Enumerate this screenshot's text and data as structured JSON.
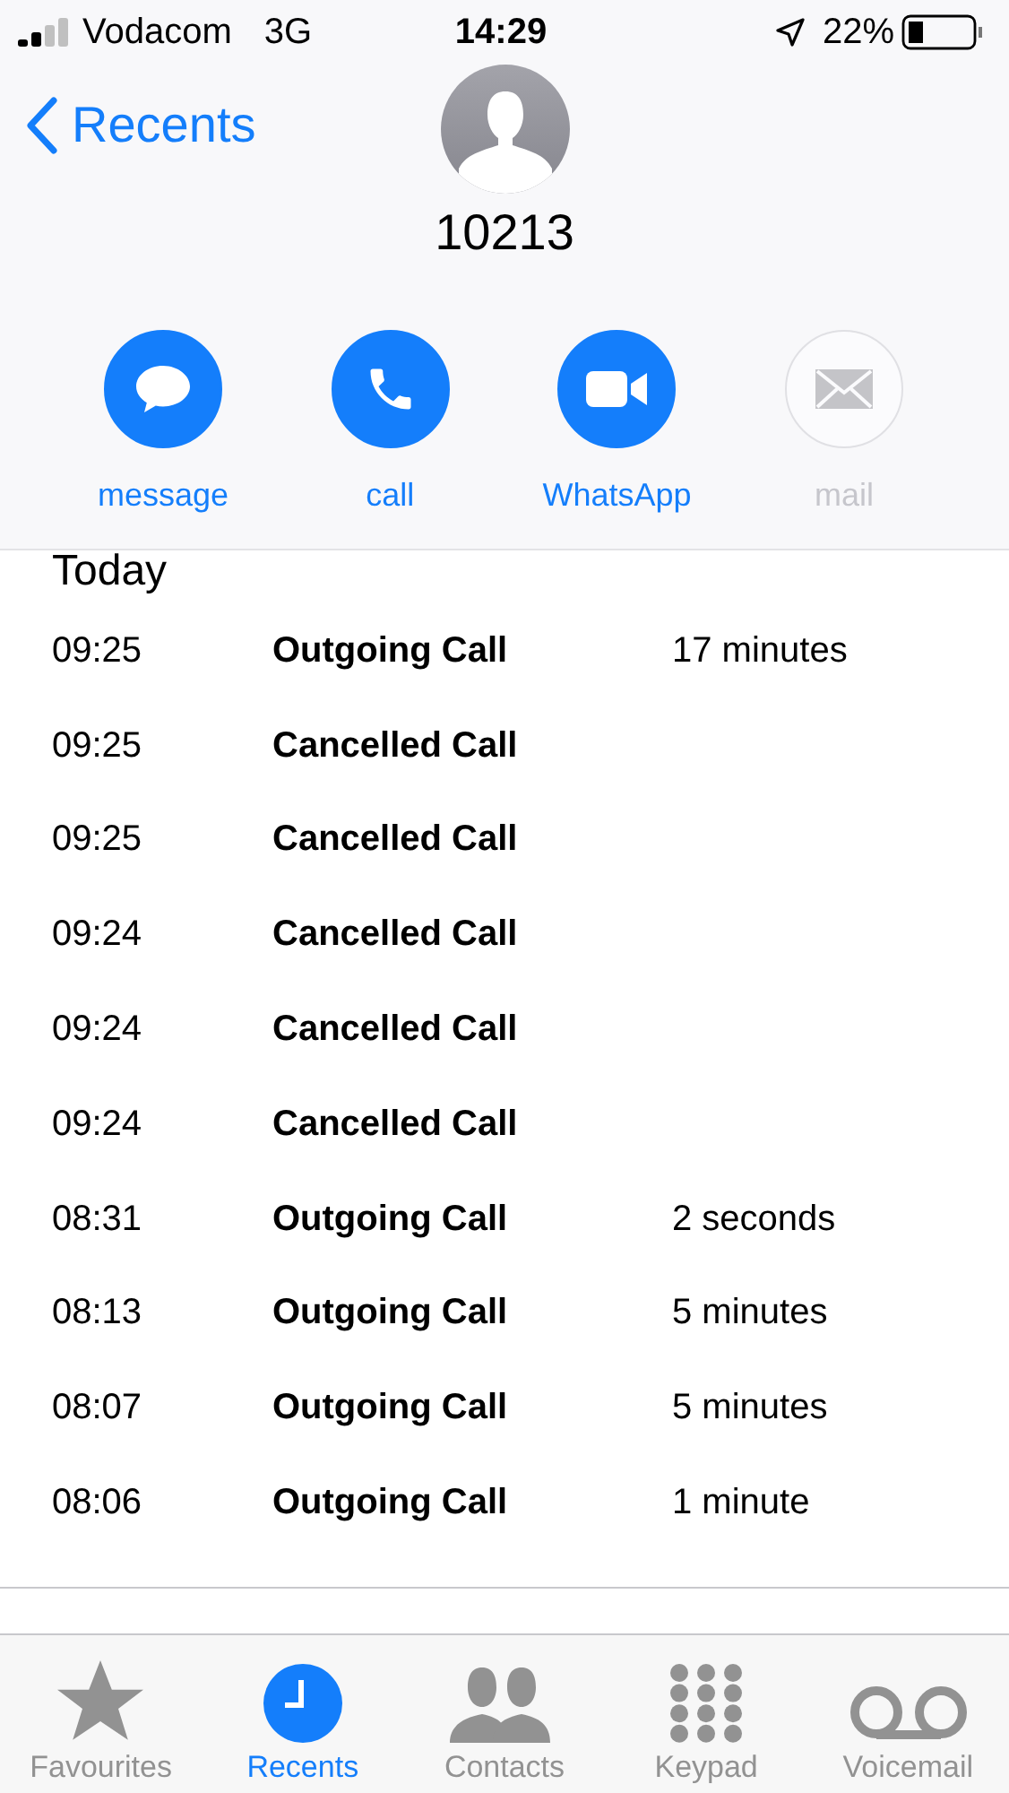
{
  "status_bar": {
    "carrier": "Vodacom",
    "network": "3G",
    "time": "14:29",
    "battery": "22%"
  },
  "nav": {
    "back": "Recents"
  },
  "contact": {
    "name": "10213"
  },
  "actions": [
    {
      "kind": "message",
      "label": "message",
      "disabled": false
    },
    {
      "kind": "call",
      "label": "call",
      "disabled": false
    },
    {
      "kind": "video",
      "label": "WhatsApp",
      "disabled": false
    },
    {
      "kind": "mail",
      "label": "mail",
      "disabled": true
    }
  ],
  "section": "Today",
  "calls": [
    {
      "time": "09:25",
      "type": "Outgoing Call",
      "duration": "17 minutes"
    },
    {
      "time": "09:25",
      "type": "Cancelled Call"
    },
    {
      "time": "09:25",
      "type": "Cancelled Call"
    },
    {
      "time": "09:24",
      "type": "Cancelled Call"
    },
    {
      "time": "09:24",
      "type": "Cancelled Call"
    },
    {
      "time": "09:24",
      "type": "Cancelled Call"
    },
    {
      "time": "08:31",
      "type": "Outgoing Call",
      "duration": "2 seconds"
    },
    {
      "time": "08:13",
      "type": "Outgoing Call",
      "duration": "5 minutes"
    },
    {
      "time": "08:07",
      "type": "Outgoing Call",
      "duration": "5 minutes"
    },
    {
      "time": "08:06",
      "type": "Outgoing Call",
      "duration": "1 minute"
    }
  ],
  "tab_bar": [
    {
      "kind": "favourites",
      "label": "Favourites",
      "selected": false
    },
    {
      "kind": "recents",
      "label": "Recents",
      "selected": true
    },
    {
      "kind": "contacts",
      "label": "Contacts",
      "selected": false
    },
    {
      "kind": "keypad",
      "label": "Keypad",
      "selected": false
    },
    {
      "kind": "voicemail",
      "label": "Voicemail",
      "selected": false
    }
  ]
}
